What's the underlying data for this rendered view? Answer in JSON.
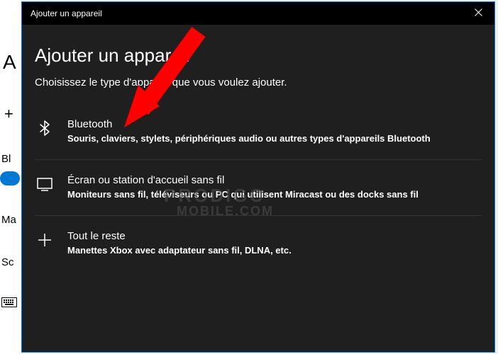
{
  "titlebar": {
    "title": "Ajouter un appareil"
  },
  "dialog": {
    "heading": "Ajouter un appareil",
    "subheading": "Choisissez le type d'appareil que vous voulez ajouter."
  },
  "options": [
    {
      "icon": "bluetooth-icon",
      "title": "Bluetooth",
      "desc": "Souris, claviers, stylets, périphériques audio ou autres types d'appareils Bluetooth"
    },
    {
      "icon": "display-icon",
      "title": "Écran ou station d'accueil sans fil",
      "desc": "Moniteurs sans fil, téléviseurs ou PC qui utilisent Miracast ou des docks sans fil"
    },
    {
      "icon": "plus-icon",
      "title": "Tout le reste",
      "desc": "Manettes Xbox avec adaptateur sans fil, DLNA, etc."
    }
  ],
  "background": {
    "partial_a": "A",
    "partial_bl": "Bl",
    "partial_ma": "Ma",
    "partial_sc": "Sc"
  },
  "watermark": {
    "line1": "PRODIGC",
    "line2": "MOBILE.COM"
  }
}
